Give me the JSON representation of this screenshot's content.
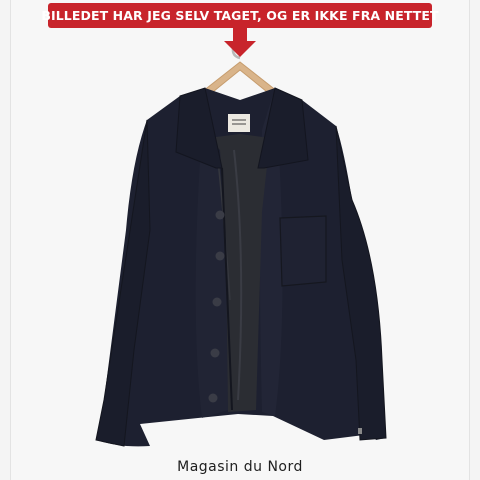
{
  "banner": {
    "text": "BILLEDET HAR JEG SELV TAGET, OG ER IKKE FRA NETTET"
  },
  "caption": {
    "text": "Magasin du Nord"
  },
  "colors": {
    "banner_red": "#c8242b",
    "jacket": "#1c1f2b",
    "background": "#f7f7f7"
  },
  "icons": [
    "arrow-down-icon"
  ]
}
